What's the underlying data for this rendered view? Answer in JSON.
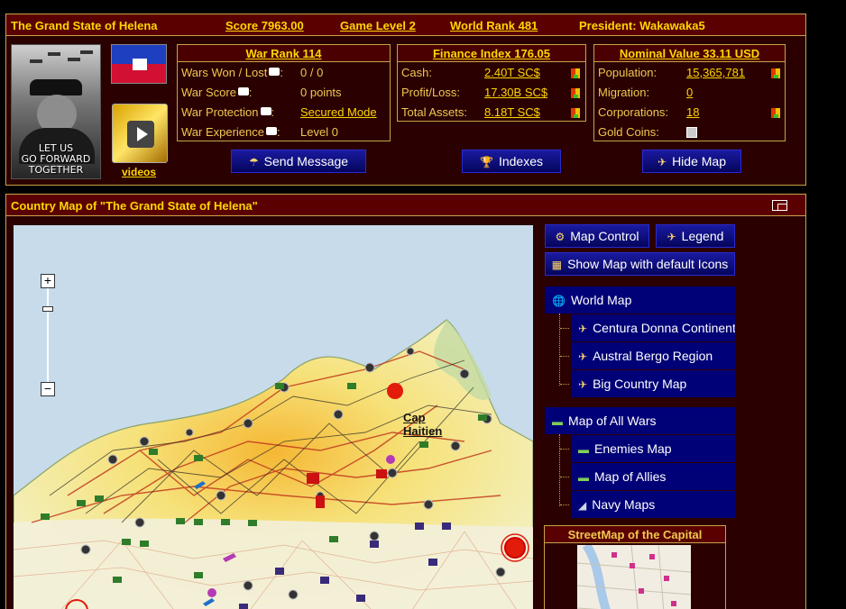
{
  "header": {
    "state_name": "The Grand State of Helena",
    "score": "Score 7963.00",
    "game_level": "Game Level 2",
    "world_rank": "World Rank 481",
    "president": "President: Wakawaka5"
  },
  "portrait": {
    "caption_lines": [
      "LET US",
      "GO FORWARD",
      "TOGETHER"
    ]
  },
  "videos_link": "videos",
  "war": {
    "title": "War Rank 114",
    "rows": [
      {
        "label": "Wars Won / Lost",
        "value": "0 / 0"
      },
      {
        "label": "War Score",
        "value": "0 points"
      },
      {
        "label": "War Protection",
        "value": "Secured Mode"
      },
      {
        "label": "War Experience",
        "value": "Level 0"
      }
    ]
  },
  "finance": {
    "title": "Finance Index 176.05",
    "rows": [
      {
        "label": "Cash:",
        "value": "2.40T SC$"
      },
      {
        "label": "Profit/Loss:",
        "value": "17.30B SC$"
      },
      {
        "label": "Total Assets:",
        "value": "8.18T SC$"
      }
    ]
  },
  "nominal": {
    "title": "Nominal Value 33.11 USD",
    "rows": [
      {
        "label": "Population:",
        "value": "15,365,781"
      },
      {
        "label": "Migration:",
        "value": "0"
      },
      {
        "label": "Corporations:",
        "value": "18"
      },
      {
        "label": "Gold Coins:",
        "value": ""
      }
    ]
  },
  "buttons": {
    "send_message": "Send Message",
    "indexes": "Indexes",
    "hide_map": "Hide Map"
  },
  "map_panel": {
    "title": "Country Map of \"The Grand State of Helena\"",
    "marker_label_line1": "Cap",
    "marker_label_line2": "Haitien",
    "zoom_in": "+",
    "zoom_out": "−"
  },
  "menu": {
    "map_control": "Map Control",
    "legend": "Legend",
    "default_icons": "Show Map with default Icons",
    "world_map": "World Map",
    "world_items": [
      "Centura Donna Continent",
      "Austral Bergo Region",
      "Big Country Map"
    ],
    "all_wars": "Map of All Wars",
    "war_items": [
      "Enemies Map",
      "Map of Allies",
      "Navy Maps"
    ],
    "streetmap_title": "StreetMap of the Capital"
  }
}
